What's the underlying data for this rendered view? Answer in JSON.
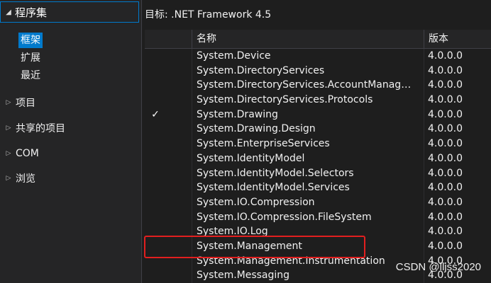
{
  "sidebar": {
    "section_label": "程序集",
    "sub_items": [
      "框架",
      "扩展",
      "最近"
    ],
    "nav_items": [
      "项目",
      "共享的项目",
      "COM",
      "浏览"
    ]
  },
  "target": "目标: .NET Framework 4.5",
  "grid": {
    "columns": [
      "名称",
      "版本"
    ],
    "rows": [
      {
        "name": "System.Device",
        "version": "4.0.0.0",
        "checked": false
      },
      {
        "name": "System.DirectoryServices",
        "version": "4.0.0.0",
        "checked": false
      },
      {
        "name": "System.DirectoryServices.AccountManage...",
        "version": "4.0.0.0",
        "checked": false
      },
      {
        "name": "System.DirectoryServices.Protocols",
        "version": "4.0.0.0",
        "checked": false
      },
      {
        "name": "System.Drawing",
        "version": "4.0.0.0",
        "checked": true
      },
      {
        "name": "System.Drawing.Design",
        "version": "4.0.0.0",
        "checked": false
      },
      {
        "name": "System.EnterpriseServices",
        "version": "4.0.0.0",
        "checked": false
      },
      {
        "name": "System.IdentityModel",
        "version": "4.0.0.0",
        "checked": false
      },
      {
        "name": "System.IdentityModel.Selectors",
        "version": "4.0.0.0",
        "checked": false
      },
      {
        "name": "System.IdentityModel.Services",
        "version": "4.0.0.0",
        "checked": false
      },
      {
        "name": "System.IO.Compression",
        "version": "4.0.0.0",
        "checked": false
      },
      {
        "name": "System.IO.Compression.FileSystem",
        "version": "4.0.0.0",
        "checked": false
      },
      {
        "name": "System.IO.Log",
        "version": "4.0.0.0",
        "checked": false
      },
      {
        "name": "System.Management",
        "version": "4.0.0.0",
        "checked": false
      },
      {
        "name": "System.Management.Instrumentation",
        "version": "4.0.0.0",
        "checked": false
      },
      {
        "name": "System.Messaging",
        "version": "4.0.0.0",
        "checked": false
      }
    ]
  },
  "watermark": "CSDN @lljss2020",
  "colors": {
    "accent": "#007acc",
    "highlight": "#e21f1f",
    "background": "#1e1e1e"
  }
}
